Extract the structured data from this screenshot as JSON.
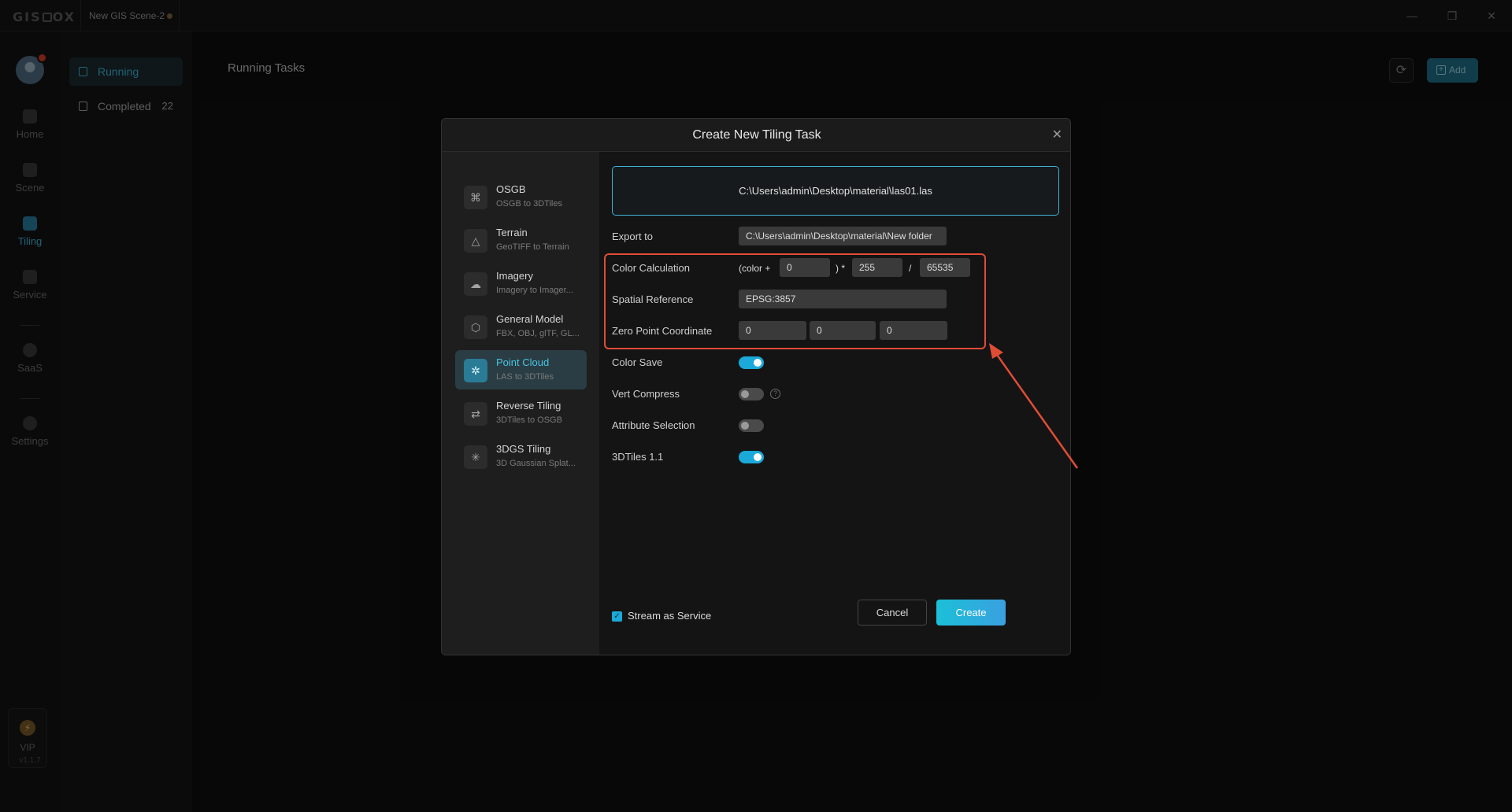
{
  "app": {
    "document_tab": "New GIS Scene-2",
    "version": "v1.1.7"
  },
  "nav": {
    "items": [
      {
        "label": "Home"
      },
      {
        "label": "Scene"
      },
      {
        "label": "Tiling"
      },
      {
        "label": "Service"
      },
      {
        "label": "SaaS"
      },
      {
        "label": "Settings"
      }
    ],
    "vip_label": "VIP"
  },
  "tasks_sidebar": {
    "running_label": "Running",
    "completed_label": "Completed",
    "completed_count": "22"
  },
  "main": {
    "title": "Running Tasks",
    "add_label": "Add"
  },
  "dialog": {
    "title": "Create New Tiling Task",
    "tools": [
      {
        "name": "OSGB",
        "desc": "OSGB to 3DTiles",
        "icon": "osgb-icon"
      },
      {
        "name": "Terrain",
        "desc": "GeoTIFF to Terrain",
        "icon": "terrain-icon"
      },
      {
        "name": "Imagery",
        "desc": "Imagery to Imager...",
        "icon": "imagery-icon"
      },
      {
        "name": "General Model",
        "desc": "FBX, OBJ, glTF, GL...",
        "icon": "model-icon"
      },
      {
        "name": "Point Cloud",
        "desc": "LAS to 3DTiles",
        "icon": "point-cloud-icon"
      },
      {
        "name": "Reverse Tiling",
        "desc": "3DTiles to OSGB",
        "icon": "reverse-tiling-icon"
      },
      {
        "name": "3DGS Tiling",
        "desc": "3D Gaussian Splat...",
        "icon": "3dgs-icon"
      }
    ],
    "input_file": "C:\\Users\\admin\\Desktop\\material\\las01.las",
    "export_label": "Export to",
    "export_value": "C:\\Users\\admin\\Desktop\\material\\New folder",
    "color_calc": {
      "label": "Color Calculation",
      "prefix": "(color +",
      "offset": "0",
      "mid": ") *",
      "multiplier": "255",
      "slash": "/",
      "divisor": "65535"
    },
    "spatial_ref": {
      "label": "Spatial Reference",
      "value": "EPSG:3857"
    },
    "zero_point": {
      "label": "Zero Point Coordinate",
      "x": "0",
      "y": "0",
      "z": "0"
    },
    "toggles": [
      {
        "label": "Color Save",
        "on": true
      },
      {
        "label": "Vert Compress",
        "on": false
      },
      {
        "label": "Attribute Selection",
        "on": false
      },
      {
        "label": "3DTiles 1.1",
        "on": true
      }
    ],
    "help_glyph": "?",
    "stream_label": "Stream as Service",
    "cancel_label": "Cancel",
    "create_label": "Create"
  },
  "colors": {
    "accent": "#3fb4d6",
    "annotation": "#e04d35",
    "create_gradient_start": "#1bc0d8"
  }
}
